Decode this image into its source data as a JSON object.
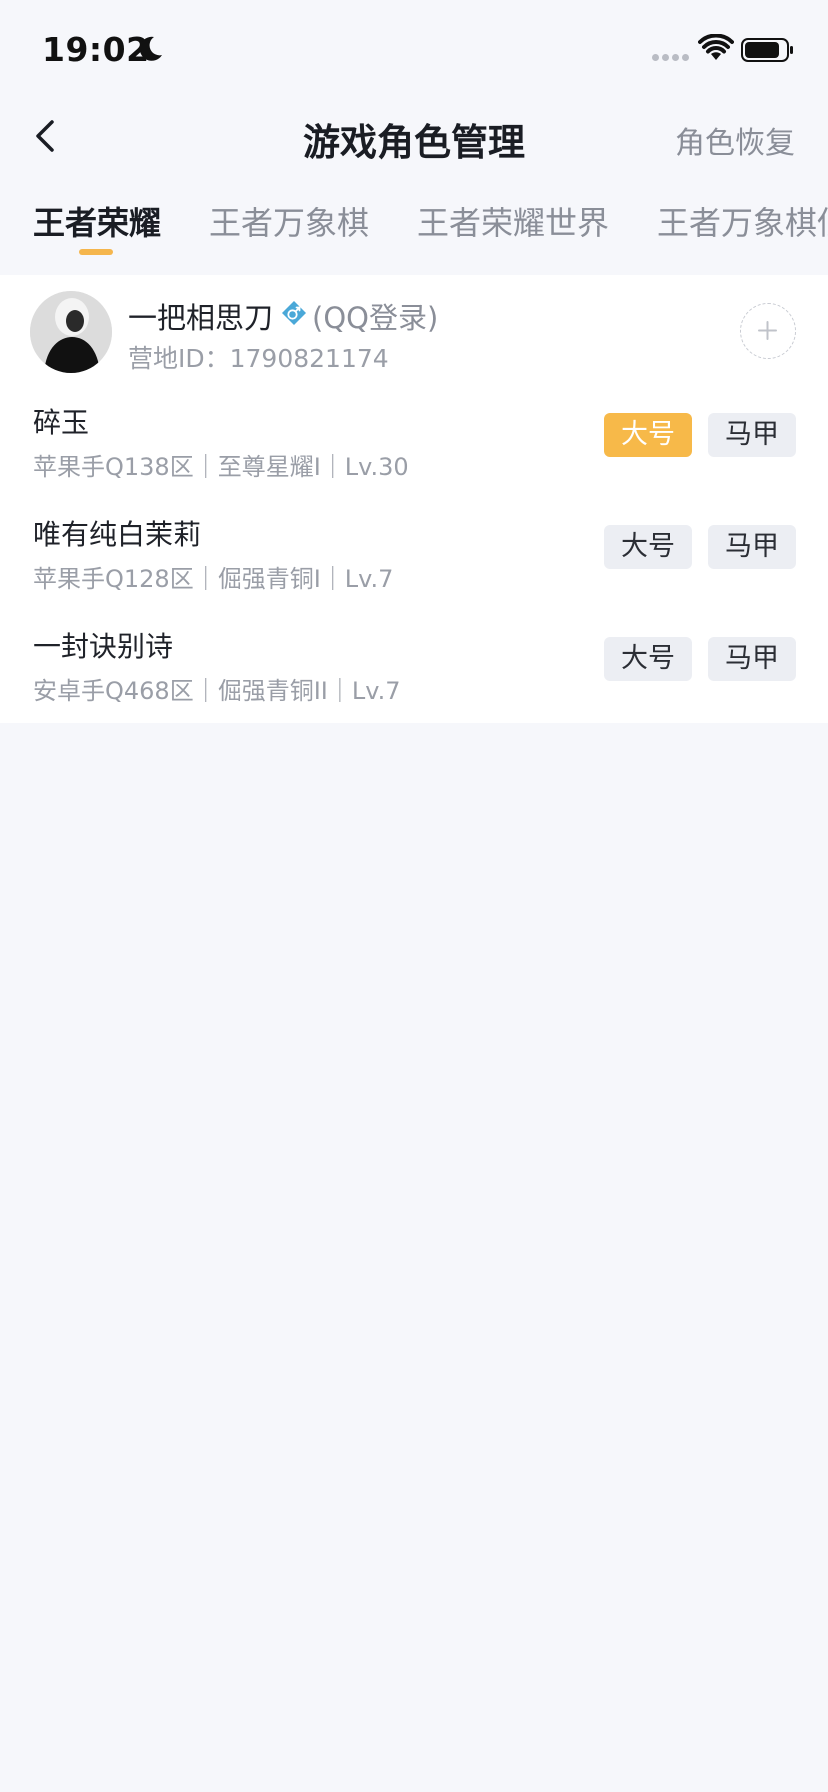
{
  "status_bar": {
    "time": "19:02",
    "icons": [
      "moon-icon",
      "signal-icon",
      "wifi-icon",
      "battery-icon"
    ]
  },
  "header": {
    "title": "游戏角色管理",
    "back_icon": "chevron-left-icon",
    "right_action": "角色恢复"
  },
  "tabs": [
    {
      "label": "王者荣耀",
      "active": true
    },
    {
      "label": "王者万象棋",
      "active": false
    },
    {
      "label": "王者荣耀世界",
      "active": false
    },
    {
      "label": "王者万象棋低",
      "active": false
    }
  ],
  "account": {
    "name": "一把相思刀",
    "gender_icon": "male-icon",
    "login_type": "(QQ登录)",
    "camp_id": "营地ID：1790821174",
    "add_icon": "plus-icon"
  },
  "roles": [
    {
      "name": "碎玉",
      "meta": "苹果手Q138区｜至尊星耀I｜Lv.30",
      "main_label": "大号",
      "alt_label": "马甲",
      "selected": "main"
    },
    {
      "name": "唯有纯白茉莉",
      "meta": "苹果手Q128区｜倔强青铜I｜Lv.7",
      "main_label": "大号",
      "alt_label": "马甲",
      "selected": "none"
    },
    {
      "name": "一封诀别诗",
      "meta": "安卓手Q468区｜倔强青铜II｜Lv.7",
      "main_label": "大号",
      "alt_label": "马甲",
      "selected": "none"
    }
  ],
  "colors": {
    "accent": "#f7b949",
    "background": "#f6f7fb",
    "card": "#ffffff",
    "gender_icon": "#4aa8d8"
  }
}
